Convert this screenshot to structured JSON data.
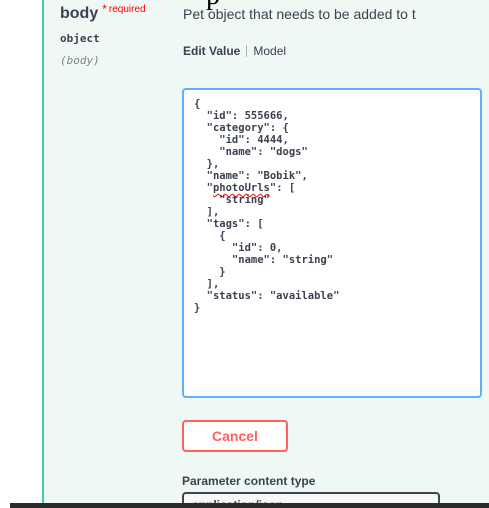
{
  "cropped_top_text": "p",
  "parameter": {
    "name": "body",
    "required_star": "*",
    "required_label": "required",
    "type": "object",
    "in": "(body)",
    "description": "Pet object that needs to be added to t"
  },
  "tabs": {
    "edit_value": "Edit Value",
    "model": "Model"
  },
  "editor": {
    "lines": [
      "{",
      "  \"id\": 555666,",
      "  \"category\": {",
      "    \"id\": 4444,",
      "    \"name\": \"dogs\"",
      "  },",
      "  \"name\": \"Bobik\",",
      "  \"photoUrls\": [",
      "    \"string\"",
      "  ],",
      "  \"tags\": [",
      "    {",
      "      \"id\": 0,",
      "      \"name\": \"string\"",
      "    }",
      "  ],",
      "  \"status\": \"available\"",
      "}"
    ],
    "misspelled_word": "photoUrls"
  },
  "cancel_label": "Cancel",
  "content_type": {
    "label": "Parameter content type",
    "selected": "application/json"
  },
  "colors": {
    "panel_bg": "#eef9f5",
    "panel_border": "#49cc90",
    "editor_border": "#61affe",
    "cancel_color": "#ff6060",
    "required_color": "#ff0000",
    "text_color": "#3b4151"
  }
}
